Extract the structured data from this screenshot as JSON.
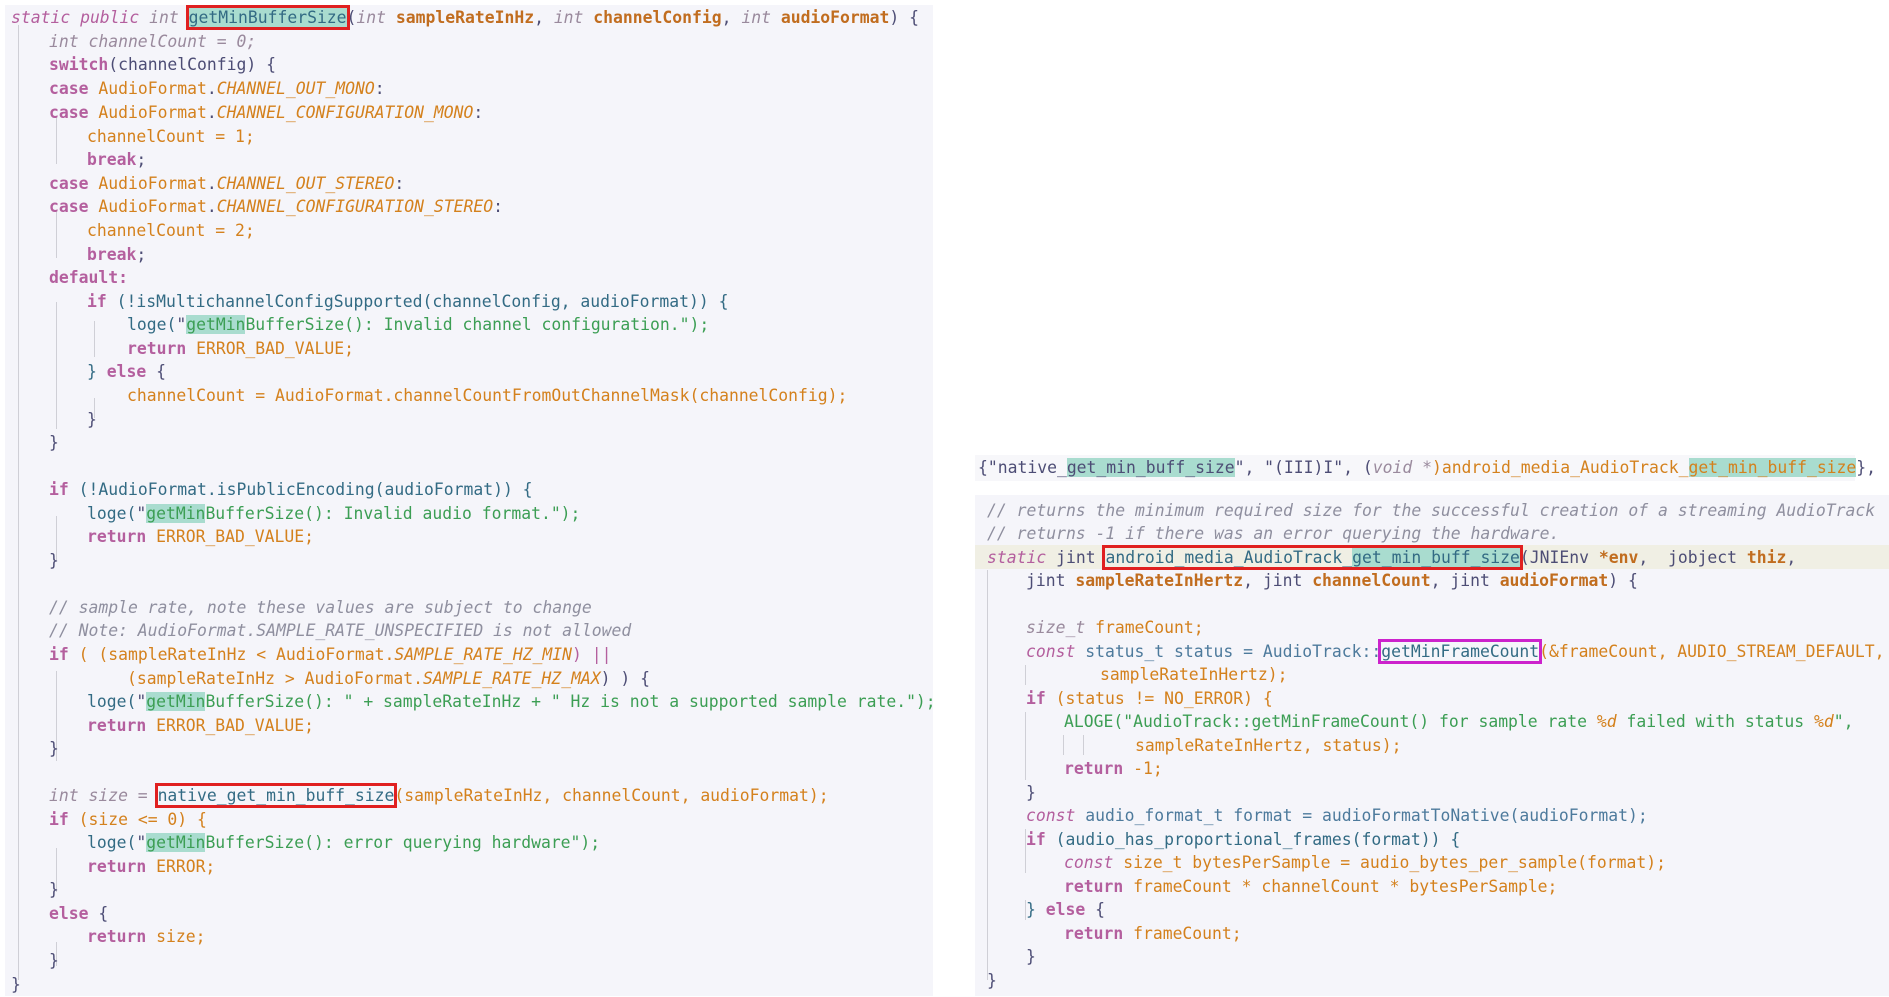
{
  "java": {
    "l1": {
      "static_public": "static public",
      "type_int": "int",
      "method": "getMinBufferSize",
      "p1type": "int",
      "p1": "sampleRateInHz",
      "p2type": "int",
      "p2": "channelConfig",
      "p3type": "int",
      "p3": "audioFormat",
      "tail": ") {",
      "sep": ", "
    },
    "l2": "int channelCount = 0;",
    "l3_kw": "switch",
    "l3_rest": "(channelConfig) {",
    "case_kw": "case",
    "cls_af": "AudioFormat",
    "c_out_mono": "CHANNEL_OUT_MONO",
    "c_cfg_mono": "CHANNEL_CONFIGURATION_MONO",
    "assign1": "channelCount = 1;",
    "break_kw": "break",
    "c_out_stereo": "CHANNEL_OUT_STEREO",
    "c_cfg_stereo": "CHANNEL_CONFIGURATION_STEREO",
    "assign2": "channelCount = 2;",
    "default_kw": "default:",
    "if_kw": "if",
    "multich": "(!isMultichannelConfigSupported(channelConfig, audioFormat)) {",
    "loge": "loge(",
    "getMin": "getMin",
    "bufsz": "BufferSize(): Invalid channel configuration.\");",
    "return_kw": "return",
    "err_bad": "ERROR_BAD_VALUE;",
    "else_close": "} ",
    "else_kw": "else",
    "brace_open": " {",
    "cc_from": "channelCount = AudioFormat.channelCountFromOutChannelMask(channelConfig);",
    "close": "}",
    "ispub": "(!AudioFormat.isPublicEncoding(audioFormat)) {",
    "invalid_fmt": "BufferSize(): Invalid audio format.\");",
    "cm1": "// sample rate, note these values are subject to change",
    "cm2": "// Note: AudioFormat.SAMPLE_RATE_UNSPECIFIED is not allowed",
    "rate_min_pre": "( (sampleRateInHz < AudioFormat.",
    "rate_min": "SAMPLE_RATE_HZ_MIN",
    "rate_min_post": ") ||",
    "rate_max_pre": "(sampleRateInHz > AudioFormat.",
    "rate_max": "SAMPLE_RATE_HZ_MAX",
    "rate_max_post": ") ) {",
    "not_supported_a": "BufferSize(): \" + sampleRateInHz + \" Hz is not a supported sample rate.\");",
    "int_size": "int size = ",
    "native_fn": "native_get_min_buff_size",
    "native_args": "(sampleRateInHz, channelCount, audioFormat);",
    "size_check": "(size <= 0) {",
    "err_query": "BufferSize(): error querying hardware\");",
    "err": "ERROR;",
    "return_size": "size;",
    "loge_q": "loge(\""
  },
  "jni_table": {
    "pre": "{\"native_",
    "hl1": "get_min_buff_size",
    "mid": "\", \"(III)I\", (",
    "void_ptr": "void *",
    "mid2": ")android_media_AudioTrack_",
    "hl2": "get_min_buff_size",
    "post": "},"
  },
  "native": {
    "cm1": "// returns the minimum required size for the successful creation of a streaming AudioTrack",
    "cm2": "// returns -1 if there was an error querying the hardware.",
    "static_kw": "static",
    "jint": "jint",
    "fn_pre": "android_media_AudioTrack_",
    "fn_hl": "get_min_buff_size",
    "sig_rest_a": "(JNIEnv ",
    "env": "*env",
    "sig_rest_b": ",  jobject ",
    "thiz": "thiz",
    "comma": ",",
    "l4_a": "jint ",
    "l4_p1": "sampleRateInHertz",
    "l4_b": ", jint ",
    "l4_p2": "channelCount",
    "l4_c": ", jint ",
    "l4_p3": "audioFormat",
    "l4_d": ") {",
    "size_t": "size_t",
    "frameCount_decl": " frameCount;",
    "const_kw": "const",
    "status_decl": " status_t status = AudioTrack::",
    "getMinFrameCount": "getMinFrameCount",
    "status_args": "(&frameCount, AUDIO_STREAM_DEFAULT,",
    "sr_hertz": "sampleRateInHertz);",
    "if_status": "(status != NO_ERROR) {",
    "aloge_a": "ALOGE(\"AudioTrack::getMinFrameCount() for sample rate ",
    "fmt_d": "%d",
    "aloge_b": " failed with status ",
    "aloge_c": "\",",
    "aloge_args": "sampleRateInHertz, status);",
    "ret_neg": "-1;",
    "fmt_decl": " audio_format_t format = audioFormatToNative(audioFormat);",
    "if_prop": "(audio_has_proportional_frames(format)) {",
    "bps_decl": " size_t bytesPerSample = audio_bytes_per_sample(format);",
    "ret_mul": "frameCount * channelCount * bytesPerSample;",
    "ret_fc": "frameCount;"
  }
}
